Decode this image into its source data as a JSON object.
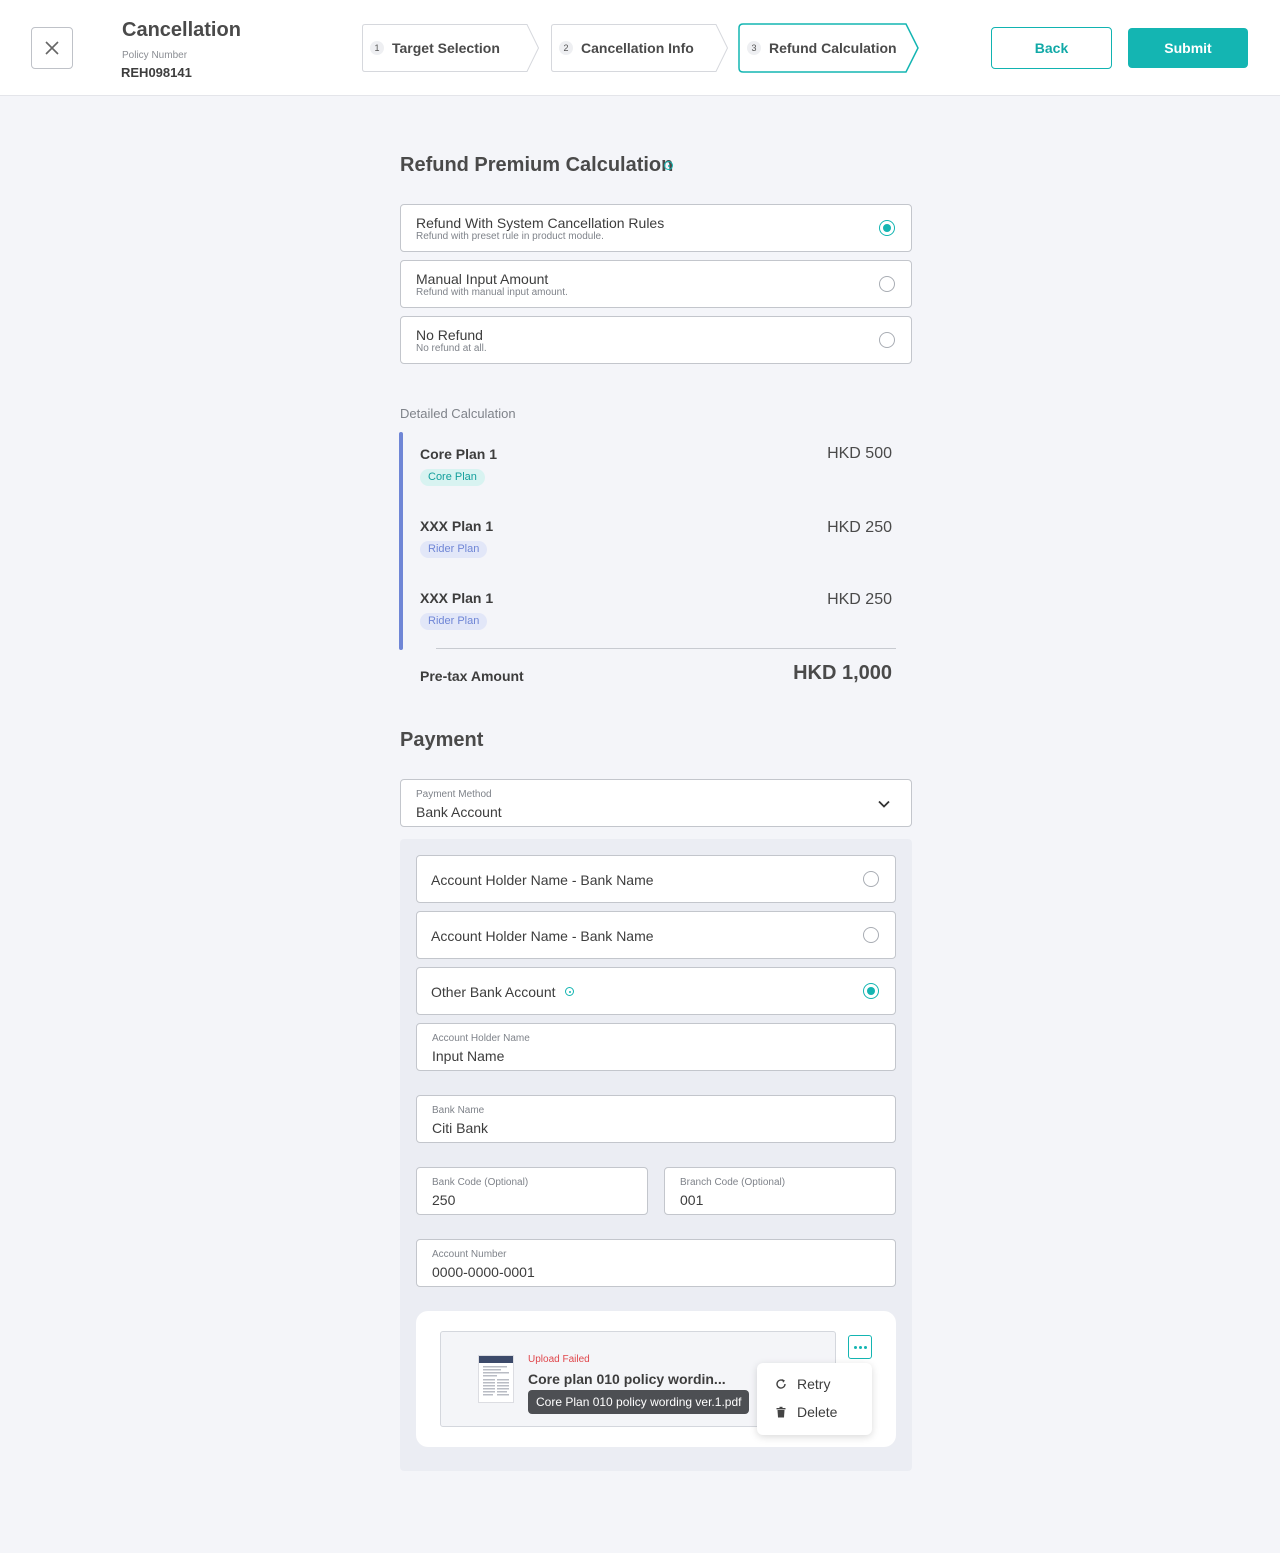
{
  "header": {
    "title": "Cancellation",
    "policy_label": "Policy Number",
    "policy_number": "REH098141",
    "steps": [
      {
        "num": "1",
        "label": "Target Selection",
        "active": false
      },
      {
        "num": "2",
        "label": "Cancellation Info",
        "active": false
      },
      {
        "num": "3",
        "label": "Refund Calculation",
        "active": true
      }
    ],
    "back_label": "Back",
    "submit_label": "Submit"
  },
  "refund": {
    "title": "Refund Premium Calculation",
    "options": [
      {
        "title": "Refund With System Cancellation Rules",
        "subtitle": "Refund with preset rule in product module.",
        "selected": true
      },
      {
        "title": "Manual Input Amount",
        "subtitle": "Refund with manual input amount.",
        "selected": false
      },
      {
        "title": "No Refund",
        "subtitle": "No refund at all.",
        "selected": false
      }
    ]
  },
  "detailed": {
    "label": "Detailed Calculation",
    "plans": [
      {
        "name": "Core Plan 1",
        "tag": "Core Plan",
        "amount": "HKD 500"
      },
      {
        "name": "XXX Plan 1",
        "tag": "Rider Plan",
        "amount": "HKD 250"
      },
      {
        "name": "XXX Plan 1",
        "tag": "Rider Plan",
        "amount": "HKD 250"
      }
    ],
    "pretax_label": "Pre-tax Amount",
    "pretax_value": "HKD 1,000"
  },
  "payment": {
    "title": "Payment",
    "method_label": "Payment Method",
    "method_value": "Bank Account",
    "accounts": [
      {
        "label": "Account Holder Name - Bank Name",
        "selected": false
      },
      {
        "label": "Account Holder Name - Bank Name",
        "selected": false
      },
      {
        "label": "Other Bank Account",
        "selected": true
      }
    ],
    "fields": {
      "holder_label": "Account Holder Name",
      "holder_value": "Input Name",
      "bank_label": "Bank Name",
      "bank_value": "Citi Bank",
      "bank_code_label": "Bank Code (Optional)",
      "bank_code_value": "250",
      "branch_code_label": "Branch Code (Optional)",
      "branch_code_value": "001",
      "account_number_label": "Account Number",
      "account_number_value": "0000-0000-0001"
    }
  },
  "upload": {
    "status": "Upload Failed",
    "file_name": "Core plan 010 policy wordin...",
    "tooltip": "Core Plan 010 policy wording ver.1.pdf",
    "menu": [
      {
        "label": "Retry",
        "icon": "refresh-icon"
      },
      {
        "label": "Delete",
        "icon": "trash-icon"
      }
    ]
  },
  "colors": {
    "accent": "#14b5b2",
    "rider": "#6f86d6",
    "error": "#e0474c"
  }
}
